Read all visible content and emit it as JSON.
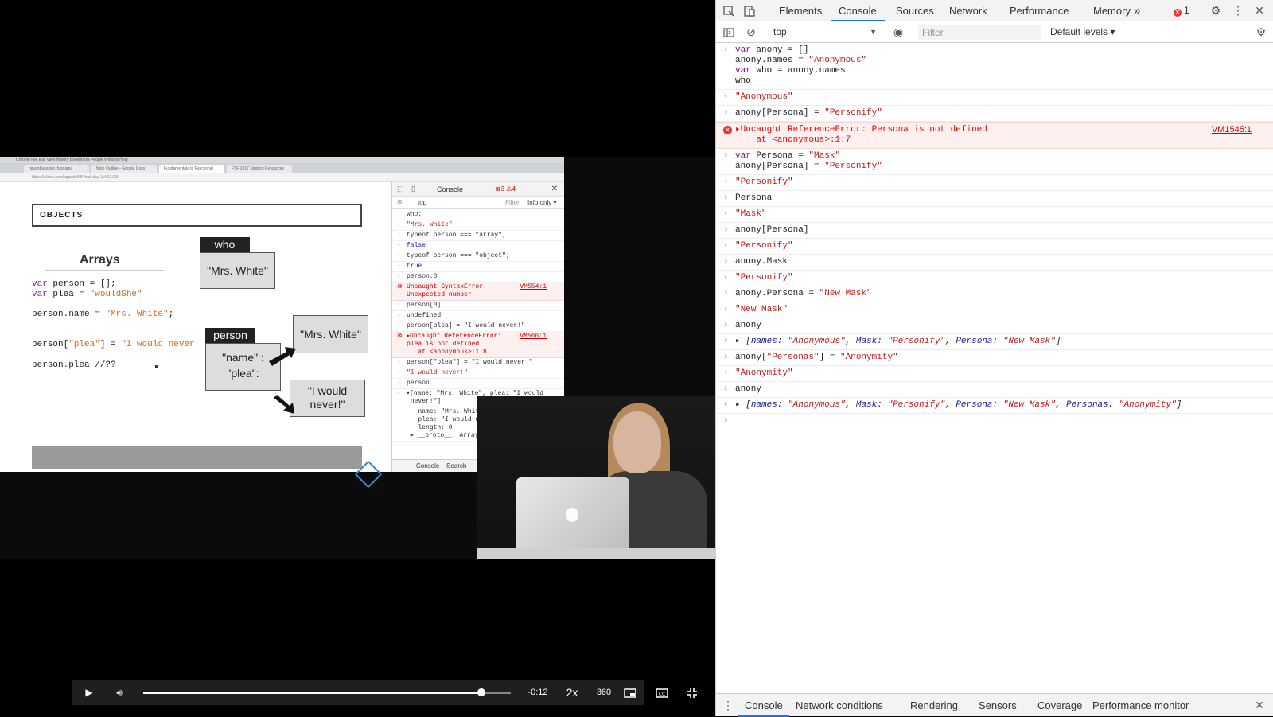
{
  "video": {
    "capture": {
      "menubar": "Chrome  File  Edit  View  History  Bookmarks  People  Window  Help",
      "tabs": [
        "ngvanbucenter. fundame",
        "Note Outline - Google Docs",
        "Fundamentals to Functional",
        "FSF 2017 Student Resources"
      ],
      "url": "https://slides.com/bgando/f2f-final-day-1/#/6/1/18"
    },
    "slide": {
      "objects_header": "OBJECTS",
      "arrays_title": "Arrays",
      "code_line1_kw": "var",
      "code_line1_rest": " person = [];",
      "code_line2_kw": "var",
      "code_line2_a": " plea = ",
      "code_line2_str": "\"wouldShe\"",
      "code_line3_a": "person.name = ",
      "code_line3_str": "\"Mrs. White\"",
      "code_line3_b": ";",
      "code_line4_a": "person[",
      "code_line4_str1": "\"plea\"",
      "code_line4_b": "] = ",
      "code_line4_str2": "\"I would never",
      "code_line5": "person.plea //??",
      "who_label": "who",
      "who_value": "\"Mrs. White\"",
      "person_label": "person",
      "person_keys": "\"name\" :\n\"plea\":",
      "mrs_white_value": "\"Mrs. White\"",
      "never_value": "\"I would\nnever!\""
    },
    "mini_devtools": {
      "tab_console": "Console",
      "errors": "⊗3 ⚠4",
      "context": "top",
      "filter": "Filter",
      "levels": "Info only ▾",
      "lines": [
        {
          "pfx": "",
          "text": "who;",
          "cls": ""
        },
        {
          "pfx": "‹",
          "text": "\"Mrs. White\"",
          "cls": "out"
        },
        {
          "pfx": "›",
          "text": "typeof person === \"array\";",
          "cls": ""
        },
        {
          "pfx": "‹",
          "text": "false",
          "cls": "blue"
        },
        {
          "pfx": "›",
          "text": "typeof person === \"object\";",
          "cls": ""
        },
        {
          "pfx": "‹",
          "text": "true",
          "cls": "blue"
        },
        {
          "pfx": "›",
          "text": "person.0",
          "cls": ""
        },
        {
          "pfx": "⊗",
          "text": "Uncaught SyntaxError:\nUnexpected number",
          "cls": "err",
          "src": "VM554:1"
        },
        {
          "pfx": "›",
          "text": "person[0]",
          "cls": ""
        },
        {
          "pfx": "‹",
          "text": "undefined",
          "cls": ""
        },
        {
          "pfx": "›",
          "text": "person[plea] = \"I would never!\"",
          "cls": ""
        },
        {
          "pfx": "⊗",
          "text": "▸Uncaught ReferenceError:\nplea is not defined\n   at <anonymous>:1:8",
          "cls": "err",
          "src": "VM566:1"
        },
        {
          "pfx": "›",
          "text": "person[\"plea\"] = \"I would never!\"",
          "cls": ""
        },
        {
          "pfx": "‹",
          "text": "\"I would never!\"",
          "cls": "out"
        },
        {
          "pfx": "›",
          "text": "person",
          "cls": ""
        },
        {
          "pfx": "‹",
          "text": "▾[name: \"Mrs. White\", plea: \"I would\n never!\"]",
          "cls": ""
        },
        {
          "pfx": "",
          "text": "   name: \"Mrs. White\"\n   plea: \"I would never!\"\n   length: 0\n ▸ __proto__: Array(0)",
          "cls": ""
        }
      ],
      "drawer_console": "Console",
      "drawer_search": "Search"
    },
    "controls": {
      "time_remaining": "-0:12",
      "speed": "2x",
      "quality": "360",
      "progress": 0.92
    }
  },
  "devtools": {
    "tabs": [
      "Elements",
      "Console",
      "Sources",
      "Network",
      "Performance",
      "Memory"
    ],
    "active_tab": "Console",
    "more_tabs": "»",
    "error_count": "1",
    "context": "top",
    "filter_placeholder": "Filter",
    "levels": "Default levels ▾",
    "console_lines": [
      {
        "type": "input",
        "html": "<span class=\"k\">var</span> anony = []\nanony.names = <span class=\"s\">\"Anonymous\"</span>\n<span class=\"k\">var</span> who = anony.names\nwho"
      },
      {
        "type": "result",
        "html": "\"Anonymous\""
      },
      {
        "type": "input",
        "html": "anony[Persona] = <span class=\"s\">\"Personify\"</span>"
      },
      {
        "type": "error",
        "html": "▸Uncaught ReferenceError: Persona is not defined\n    at &lt;anonymous&gt;:1:7",
        "src": "VM1545:1"
      },
      {
        "type": "input",
        "html": "<span class=\"k\">var</span> Persona = <span class=\"s\">\"Mask\"</span>\nanony[Persona] = <span class=\"s\">\"Personify\"</span>"
      },
      {
        "type": "result",
        "html": "\"Personify\""
      },
      {
        "type": "input",
        "html": "Persona"
      },
      {
        "type": "result",
        "html": "\"Mask\""
      },
      {
        "type": "input",
        "html": "anony[Persona]"
      },
      {
        "type": "result",
        "html": "\"Personify\""
      },
      {
        "type": "input",
        "html": "anony.Mask"
      },
      {
        "type": "result",
        "html": "\"Personify\""
      },
      {
        "type": "input",
        "html": "anony.Persona = <span class=\"s\">\"New Mask\"</span>"
      },
      {
        "type": "result",
        "html": "\"New Mask\""
      },
      {
        "type": "input",
        "html": "anony"
      },
      {
        "type": "obj",
        "html": "▸ [<span class=\"p\">names</span>: <span class=\"s\">\"Anonymous\"</span>, <span class=\"p\">Mask</span>: <span class=\"s\">\"Personify\"</span>, <span class=\"p\">Persona</span>: <span class=\"s\">\"New Mask\"</span>]"
      },
      {
        "type": "input",
        "html": "anony[<span class=\"s\">\"Personas\"</span>] = <span class=\"s\">\"Anonymity\"</span>"
      },
      {
        "type": "result",
        "html": "\"Anonymity\""
      },
      {
        "type": "input",
        "html": "anony"
      },
      {
        "type": "obj",
        "html": "▸ [<span class=\"p\">names</span>: <span class=\"s\">\"Anonymous\"</span>, <span class=\"p\">Mask</span>: <span class=\"s\">\"Personify\"</span>, <span class=\"p\">Persona</span>: <span class=\"s\">\"New Mask\"</span>, <span class=\"p\">Personas</span>: <span class=\"s\">\"Anonymity\"</span>]"
      }
    ],
    "drawer_tabs": [
      "Console",
      "Network conditions",
      "Rendering",
      "Sensors",
      "Coverage",
      "Performance monitor"
    ],
    "drawer_active": "Console"
  }
}
